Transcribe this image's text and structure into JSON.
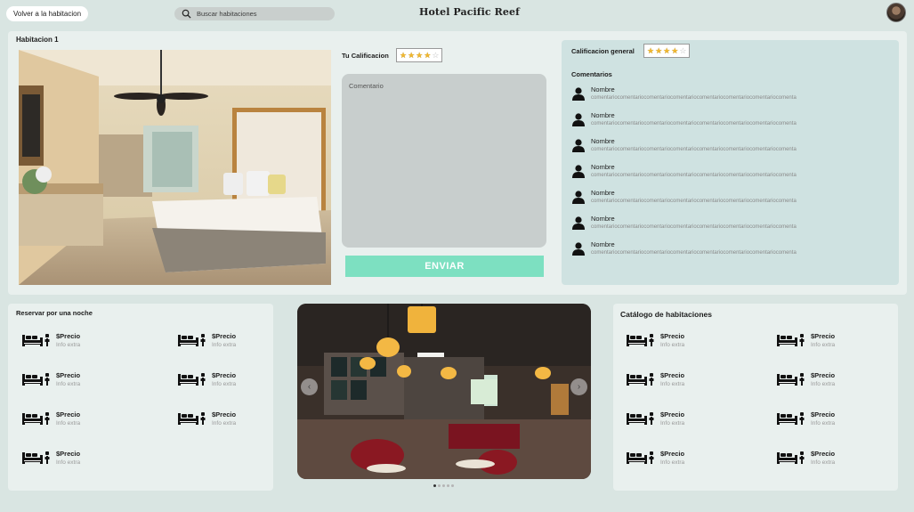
{
  "header": {
    "back_label": "Volver a la habitacion",
    "search_placeholder": "Buscar habitaciones",
    "brand": "Hotel Pacific Reef"
  },
  "room": {
    "title": "Habitacion 1",
    "your_rating_label": "Tu Calificacion",
    "your_rating": 4,
    "comment_placeholder": "Comentario",
    "send_label": "ENVIAR"
  },
  "reviews": {
    "general_label": "Calificacion general",
    "general_rating": 4,
    "comments_title": "Comentarios",
    "items": [
      {
        "name": "Nombre",
        "text": "comentariocomentariocomentariocomentariocomentariocomentariocomentariocomenta"
      },
      {
        "name": "Nombre",
        "text": "comentariocomentariocomentariocomentariocomentariocomentariocomentariocomenta"
      },
      {
        "name": "Nombre",
        "text": "comentariocomentariocomentariocomentariocomentariocomentariocomentariocomenta"
      },
      {
        "name": "Nombre",
        "text": "comentariocomentariocomentariocomentariocomentariocomentariocomentariocomenta"
      },
      {
        "name": "Nombre",
        "text": "comentariocomentariocomentariocomentariocomentariocomentariocomentariocomenta"
      },
      {
        "name": "Nombre",
        "text": "comentariocomentariocomentariocomentariocomentariocomentariocomentariocomenta"
      },
      {
        "name": "Nombre",
        "text": "comentariocomentariocomentariocomentariocomentariocomentariocomentariocomenta"
      }
    ]
  },
  "reserve": {
    "title": "Reservar por una noche",
    "items": [
      {
        "price": "$Precio",
        "extra": "Info extra"
      },
      {
        "price": "$Precio",
        "extra": "Info extra"
      },
      {
        "price": "$Precio",
        "extra": "Info extra"
      },
      {
        "price": "$Precio",
        "extra": "Info extra"
      },
      {
        "price": "$Precio",
        "extra": "Info extra"
      },
      {
        "price": "$Precio",
        "extra": "Info extra"
      },
      {
        "price": "$Precio",
        "extra": "Info extra"
      }
    ]
  },
  "carousel": {
    "prev_icon": "chevron-left-icon",
    "next_icon": "chevron-right-icon",
    "slide_count": 5,
    "active_slide": 1
  },
  "catalog": {
    "title": "Catálogo de habitaciones",
    "items": [
      {
        "price": "$Precio",
        "extra": "Info extra"
      },
      {
        "price": "$Precio",
        "extra": "Info extra"
      },
      {
        "price": "$Precio",
        "extra": "Info extra"
      },
      {
        "price": "$Precio",
        "extra": "Info extra"
      },
      {
        "price": "$Precio",
        "extra": "Info extra"
      },
      {
        "price": "$Precio",
        "extra": "Info extra"
      },
      {
        "price": "$Precio",
        "extra": "Info extra"
      },
      {
        "price": "$Precio",
        "extra": "Info extra"
      }
    ]
  },
  "colors": {
    "accent": "#7de0c1",
    "star": "#f1b72e",
    "background": "#d9e5e2",
    "panel": "#e9f0ee",
    "reviews_panel": "#cfe2e1"
  }
}
